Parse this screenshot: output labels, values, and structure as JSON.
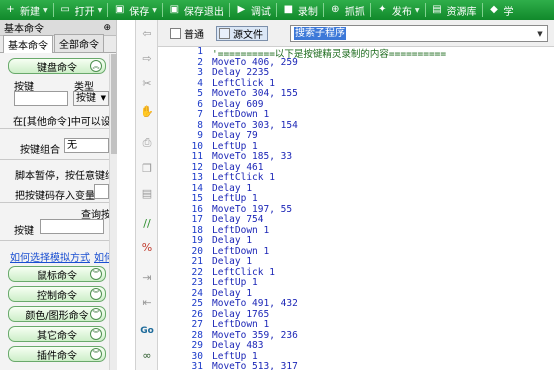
{
  "toolbar": {
    "items": [
      {
        "label": "新建",
        "icon": "plus-icon",
        "glyph": "+",
        "dropdown": true
      },
      {
        "label": "打开",
        "icon": "folder-icon",
        "glyph": "▭",
        "dropdown": true
      },
      {
        "label": "保存",
        "icon": "save-icon",
        "glyph": "▣",
        "dropdown": true
      },
      {
        "label": "保存退出",
        "icon": "save-exit-icon",
        "glyph": "▣",
        "dropdown": false
      },
      {
        "label": "调试",
        "icon": "play-icon",
        "glyph": "▶",
        "dropdown": false
      },
      {
        "label": "录制",
        "icon": "record-icon",
        "glyph": "■",
        "dropdown": false
      },
      {
        "label": "抓抓",
        "icon": "grab-icon",
        "glyph": "⊕",
        "dropdown": false
      },
      {
        "label": "发布",
        "icon": "publish-icon",
        "glyph": "✦",
        "dropdown": true
      },
      {
        "label": "资源库",
        "icon": "library-icon",
        "glyph": "▤",
        "dropdown": false
      },
      {
        "label": "学",
        "icon": "learn-icon",
        "glyph": "◆",
        "dropdown": false
      }
    ]
  },
  "left_panel": {
    "title": "基本命令",
    "pin_glyph": "⊕",
    "tabs": [
      "基本命令",
      "全部命令"
    ],
    "keyboard_group": "键盘命令",
    "key_label": "按键",
    "type_label": "类型",
    "type_value": "按键",
    "other_cmd_text": "在[其他命令]中可以设定键",
    "combo_label": "按键组合",
    "combo_value": "无",
    "pause_text": "脚本暂停，按任意键继续",
    "store_text": "把按键码存入变量",
    "query_label": "查询按键",
    "key2_label": "按键",
    "link1": "如何选择模拟方式",
    "link2": "如何",
    "groups": [
      "鼠标命令",
      "控制命令",
      "颜色/图形命令",
      "其它命令",
      "插件命令"
    ]
  },
  "editor_header": {
    "normal_label": "普通",
    "source_label": "源文件",
    "search_value": "搜索子程序"
  },
  "editor": {
    "lines": [
      {
        "n": "1",
        "text": "'==========以下是按键精灵录制的内容==========",
        "comment": true
      },
      {
        "n": "2",
        "text": "MoveTo 406, 259"
      },
      {
        "n": "3",
        "text": "Delay 2235"
      },
      {
        "n": "4",
        "text": "LeftClick 1"
      },
      {
        "n": "5",
        "text": "MoveTo 304, 155"
      },
      {
        "n": "6",
        "text": "Delay 609"
      },
      {
        "n": "7",
        "text": "LeftDown 1"
      },
      {
        "n": "8",
        "text": "MoveTo 303, 154"
      },
      {
        "n": "9",
        "text": "Delay 79"
      },
      {
        "n": "10",
        "text": "LeftUp 1"
      },
      {
        "n": "11",
        "text": "MoveTo 185, 33"
      },
      {
        "n": "12",
        "text": "Delay 461"
      },
      {
        "n": "13",
        "text": "LeftClick 1"
      },
      {
        "n": "14",
        "text": "Delay 1"
      },
      {
        "n": "15",
        "text": "LeftUp 1"
      },
      {
        "n": "16",
        "text": "MoveTo 197, 55"
      },
      {
        "n": "17",
        "text": "Delay 754"
      },
      {
        "n": "18",
        "text": "LeftDown 1"
      },
      {
        "n": "19",
        "text": "Delay 1"
      },
      {
        "n": "20",
        "text": "LeftDown 1"
      },
      {
        "n": "21",
        "text": "Delay 1"
      },
      {
        "n": "22",
        "text": "LeftClick 1"
      },
      {
        "n": "23",
        "text": "LeftUp 1"
      },
      {
        "n": "24",
        "text": "Delay 1"
      },
      {
        "n": "25",
        "text": "MoveTo 491, 432"
      },
      {
        "n": "26",
        "text": "Delay 1765"
      },
      {
        "n": "27",
        "text": "LeftDown 1"
      },
      {
        "n": "28",
        "text": "MoveTo 359, 236"
      },
      {
        "n": "29",
        "text": "Delay 483"
      },
      {
        "n": "30",
        "text": "LeftUp 1"
      },
      {
        "n": "31",
        "text": "MoveTo 513, 317"
      }
    ]
  },
  "vstrip_icons": [
    {
      "name": "undo-icon",
      "glyph": "⇦"
    },
    {
      "name": "redo-icon",
      "glyph": "⇨"
    },
    {
      "name": "cut-icon",
      "glyph": "✂"
    },
    {
      "name": "hand-icon",
      "glyph": "✋"
    },
    {
      "name": "print-icon",
      "glyph": "⎙"
    },
    {
      "name": "copy-icon",
      "glyph": "❐"
    },
    {
      "name": "paste-icon",
      "glyph": "▤"
    },
    {
      "name": "comment-icon",
      "glyph": "//"
    },
    {
      "name": "uncomment-icon",
      "glyph": "%"
    },
    {
      "name": "indent-icon",
      "glyph": "⇥"
    },
    {
      "name": "outdent-icon",
      "glyph": "⇤"
    },
    {
      "name": "goto-icon",
      "glyph": "Go"
    },
    {
      "name": "binoculars-icon",
      "glyph": "∞"
    }
  ],
  "colors": {
    "toolbar_green": "#1c9a36",
    "code_blue": "#1d27b7",
    "comment_green": "#1e6b1e",
    "line_number_blue": "#1a39c8",
    "link_blue": "#1a4fd1"
  }
}
